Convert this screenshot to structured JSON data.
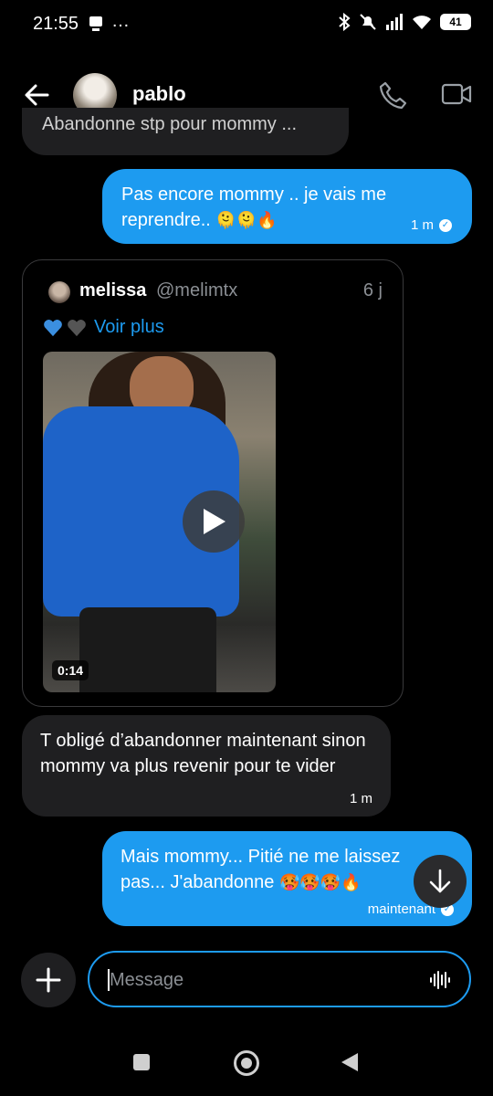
{
  "status_bar": {
    "time": "21:55",
    "extra": "…",
    "battery": "41"
  },
  "header": {
    "name": "pablo"
  },
  "messages": {
    "cut_text": "Abandonne stp pour mommy ...",
    "m1": {
      "text": "Pas encore mommy .. je vais me reprendre.. ",
      "emoji": "🫠🫠🔥",
      "time": "1 m"
    },
    "quote": {
      "name": "melissa",
      "handle": "@melimtx",
      "time": "6 j",
      "more": "Voir plus",
      "duration": "0:14"
    },
    "m2": {
      "text": "T obligé d’abandonner maintenant sinon mommy va plus revenir pour te vider",
      "time": "1 m"
    },
    "m3": {
      "text": "Mais mommy... Pitié ne me laissez pas... J'abandonne ",
      "emoji": "🥵🥵🥵🔥",
      "time": "maintenant"
    }
  },
  "composer": {
    "placeholder": "Message"
  },
  "colors": {
    "accent": "#1d9bf0",
    "incoming": "#1f1f21",
    "background": "#000000"
  },
  "icons": [
    "back-arrow-icon",
    "phone-icon",
    "video-icon",
    "play-icon",
    "arrow-down-icon",
    "plus-icon",
    "audio-wave-icon"
  ]
}
